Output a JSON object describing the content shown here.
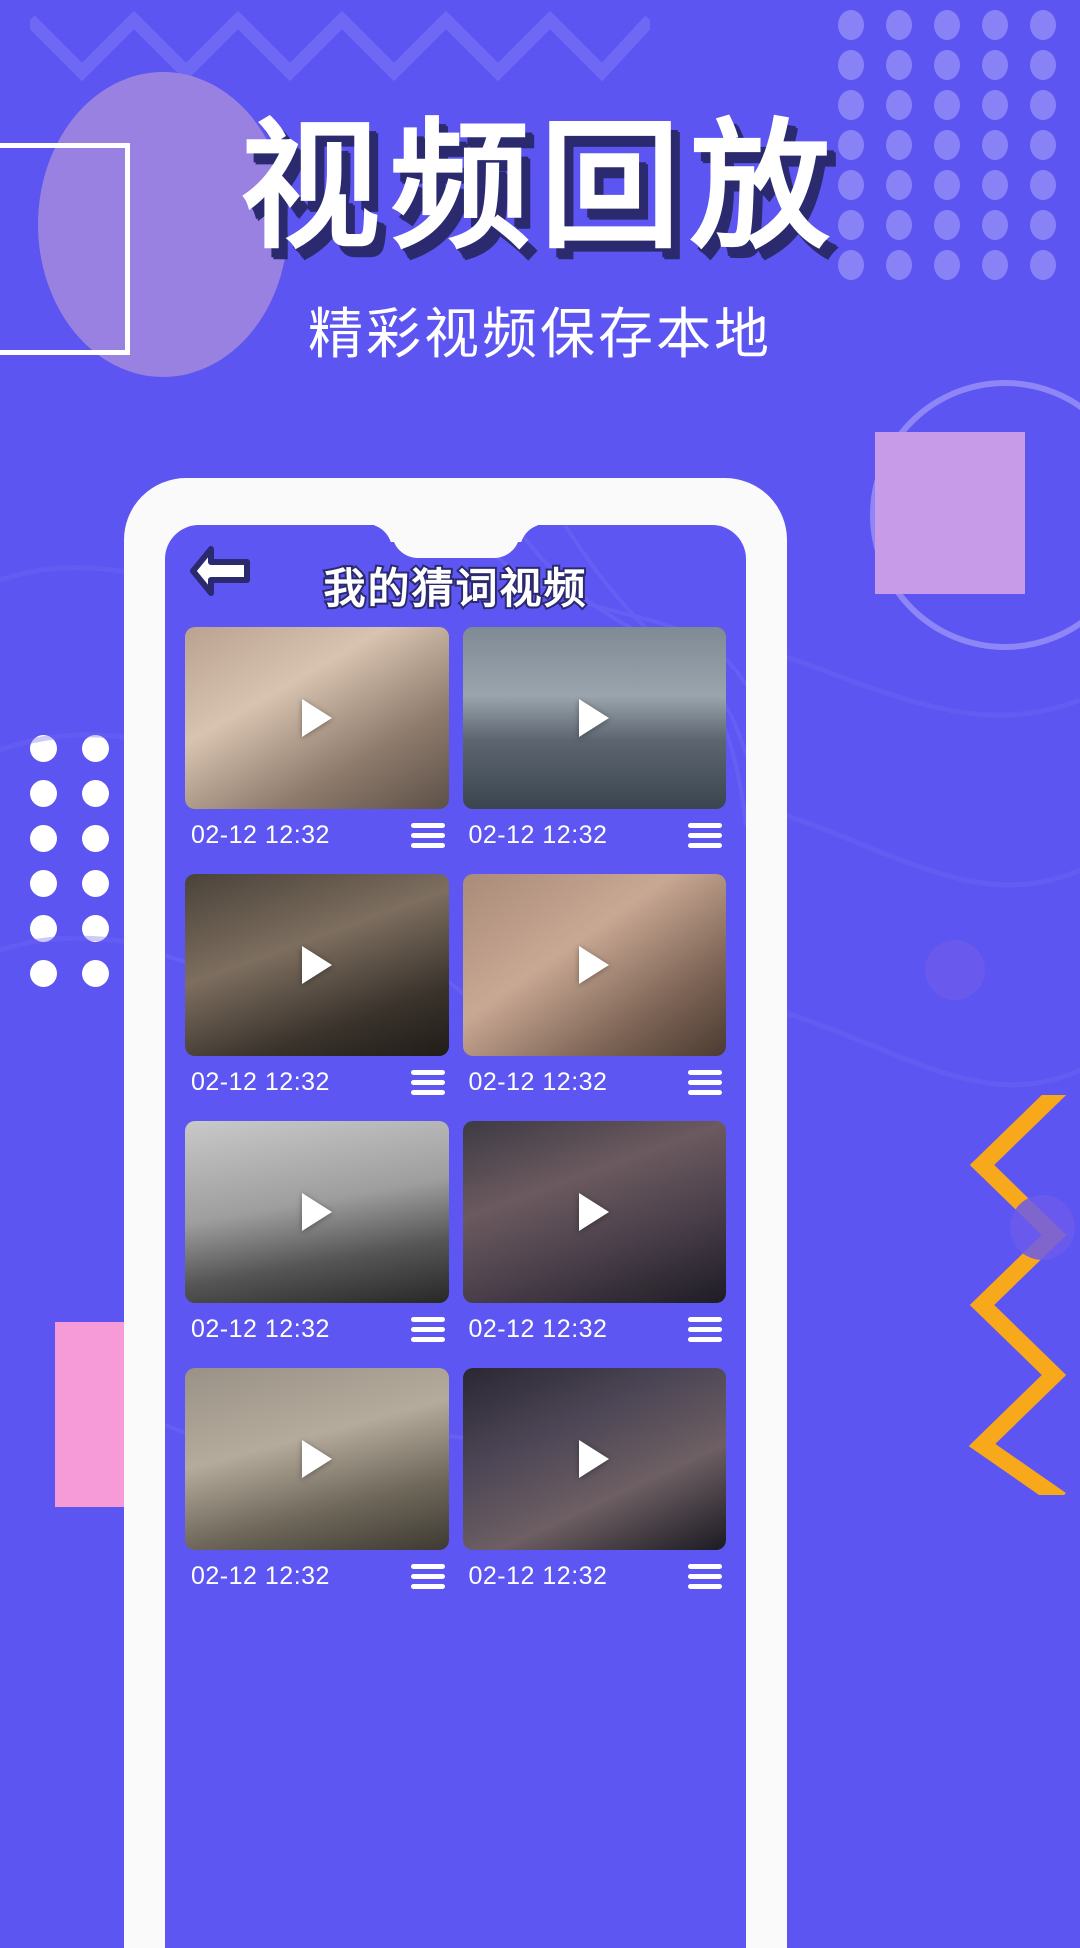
{
  "theme": {
    "bg_purple": "#5C55F2",
    "screen_purple": "#5D56F3",
    "title_shadow_navy": "#2B2A6E",
    "accent_orange": "#F7A81B",
    "accent_pink": "#F79BD8",
    "deco_violet": "#9B84DE",
    "white": "#FFFFFF"
  },
  "hero": {
    "title": "视频回放",
    "subtitle": "精彩视频保存本地"
  },
  "app": {
    "back_icon": "arrow-left-icon",
    "title": "我的猜词视频",
    "menu_icon": "hamburger-icon",
    "play_icon": "play-icon",
    "videos": [
      {
        "timestamp": "02-12 12:32",
        "thumb": "girl-bed-i-love-you"
      },
      {
        "timestamp": "02-12 12:32",
        "thumb": "woman-coat-city-view"
      },
      {
        "timestamp": "02-12 12:32",
        "thumb": "girl-panda-hoodie"
      },
      {
        "timestamp": "02-12 12:32",
        "thumb": "man-hand-gesture-face"
      },
      {
        "timestamp": "02-12 12:32",
        "thumb": "man-silhouette-bw-arch"
      },
      {
        "timestamp": "02-12 12:32",
        "thumb": "girl-peace-sign-night"
      },
      {
        "timestamp": "02-12 12:32",
        "thumb": "man-trench-coat-wall"
      },
      {
        "timestamp": "02-12 12:32",
        "thumb": "woman-sparkler-night"
      }
    ]
  },
  "decorations": {
    "zigzag_top": "zigzag-line-top",
    "zigzag_right": "zigzag-line-orange-right",
    "dots_top_right": "dot-grid-top-right",
    "dots_left": "dot-grid-left",
    "ellipse": "ellipse-violet",
    "square_outline": "square-outline-white",
    "square_pink_right": "square-violet-right",
    "square_pink_bottom": "square-pink-bottom-left",
    "ring_right": "ring-outline-right"
  }
}
